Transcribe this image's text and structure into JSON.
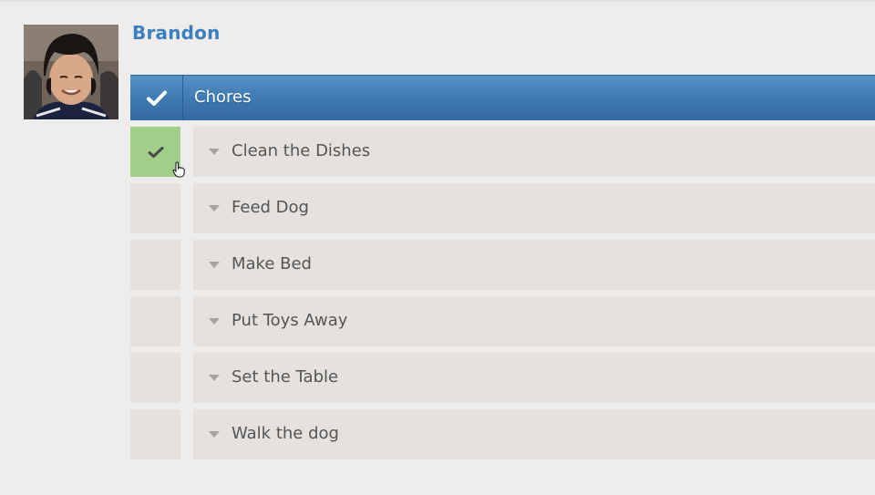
{
  "user": {
    "name": "Brandon",
    "avatar_icon": "child-avatar-photo"
  },
  "list": {
    "title": "Chores",
    "header_icon": "check-icon"
  },
  "tasks": [
    {
      "label": "Clean the Dishes",
      "done": true
    },
    {
      "label": "Feed Dog",
      "done": false
    },
    {
      "label": "Make Bed",
      "done": false
    },
    {
      "label": "Put Toys Away",
      "done": false
    },
    {
      "label": "Set the Table",
      "done": false
    },
    {
      "label": "Walk the dog",
      "done": false
    }
  ],
  "colors": {
    "accent_blue": "#3d78b0",
    "name_blue": "#3b7fbf",
    "done_green": "#9fcf88",
    "row_bg": "#e4e1de",
    "page_bg": "#efedeb"
  }
}
